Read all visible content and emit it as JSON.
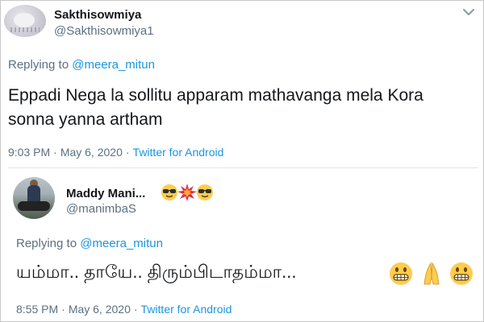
{
  "tweets": [
    {
      "display_name": "Sakthisowmiya",
      "handle": "@Sakthisowmiya1",
      "replying_prefix": "Replying to",
      "replying_to": "@meera_mitun",
      "text": "Eppadi Nega la sollitu apparam mathavanga mela Kora sonna yanna artham",
      "time": "9:03 PM",
      "date": "May 6, 2020",
      "source": "Twitter for Android"
    },
    {
      "display_name": "Maddy Mani...",
      "handle": "@manimbaS",
      "replying_prefix": "Replying to",
      "replying_to": "@meera_mitun",
      "text": "யம்மா.. தாயே.. திரும்பிடாதம்மா...",
      "time": "8:55 PM",
      "date": "May 6, 2020",
      "source": "Twitter for Android"
    }
  ],
  "separator": "·",
  "name_emojis": [
    "sunglasses-face",
    "collision",
    "sunglasses-face"
  ],
  "text_emojis": [
    "grimacing-face",
    "folded-hands",
    "grimacing-face"
  ],
  "colors": {
    "link": "#1b95e0",
    "secondary_text": "#5b7083",
    "primary_text": "#14171a",
    "divider": "#e1e8ed"
  }
}
